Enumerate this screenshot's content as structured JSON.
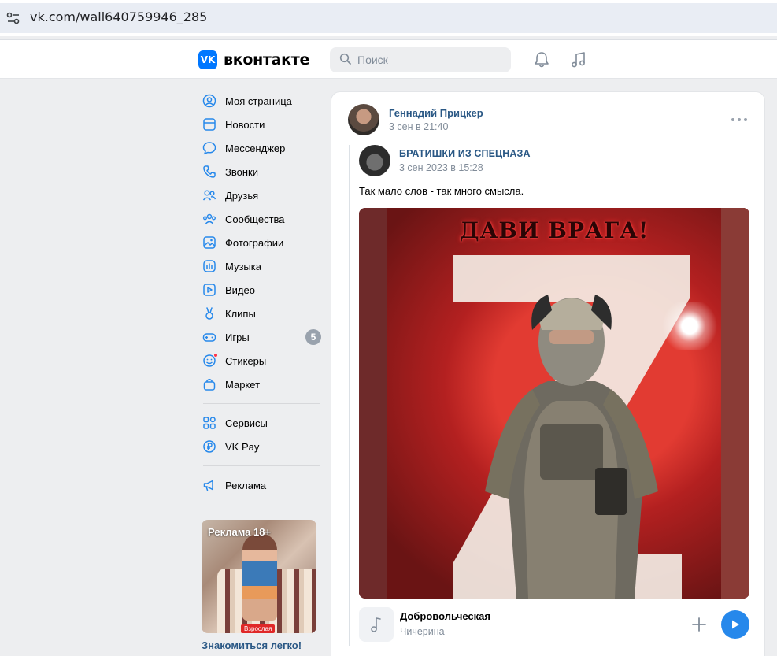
{
  "browser": {
    "url": "vk.com/wall640759946_285"
  },
  "header": {
    "logo_mark": "VK",
    "logo_text": "вконтакте",
    "search_placeholder": "Поиск"
  },
  "sidebar": {
    "items": [
      {
        "label": "Моя страница",
        "icon": "user-circle-icon"
      },
      {
        "label": "Новости",
        "icon": "news-icon"
      },
      {
        "label": "Мессенджер",
        "icon": "message-icon"
      },
      {
        "label": "Звонки",
        "icon": "phone-icon"
      },
      {
        "label": "Друзья",
        "icon": "friends-icon"
      },
      {
        "label": "Сообщества",
        "icon": "communities-icon"
      },
      {
        "label": "Фотографии",
        "icon": "photo-icon"
      },
      {
        "label": "Музыка",
        "icon": "music-icon"
      },
      {
        "label": "Видео",
        "icon": "video-icon"
      },
      {
        "label": "Клипы",
        "icon": "clips-icon"
      },
      {
        "label": "Игры",
        "icon": "gamepad-icon",
        "badge": "5"
      },
      {
        "label": "Стикеры",
        "icon": "sticker-icon"
      },
      {
        "label": "Маркет",
        "icon": "shopping-bag-icon"
      }
    ],
    "secondary": [
      {
        "label": "Сервисы",
        "icon": "services-icon"
      },
      {
        "label": "VK Pay",
        "icon": "ruble-icon"
      }
    ],
    "tertiary": [
      {
        "label": "Реклама",
        "icon": "megaphone-icon"
      }
    ]
  },
  "ad": {
    "tag": "Реклама 18+",
    "age_label": "Взрослая",
    "title": "Знакомиться легко!"
  },
  "post": {
    "author": "Геннадий Прицкер",
    "date": "3 сен в 21:40",
    "repost": {
      "author": "БРАТИШКИ ИЗ СПЕЦНАЗА",
      "date": "3 сен 2023 в 15:28",
      "text": "Так мало слов - так много смысла.",
      "image_caption": "ДАВИ ВРАГА!"
    },
    "track": {
      "title": "Добровольческая",
      "artist": "Чичерина"
    }
  },
  "colors": {
    "accent": "#2688eb",
    "link": "#2a5885",
    "brand": "#0077ff",
    "muted": "#818c99"
  }
}
